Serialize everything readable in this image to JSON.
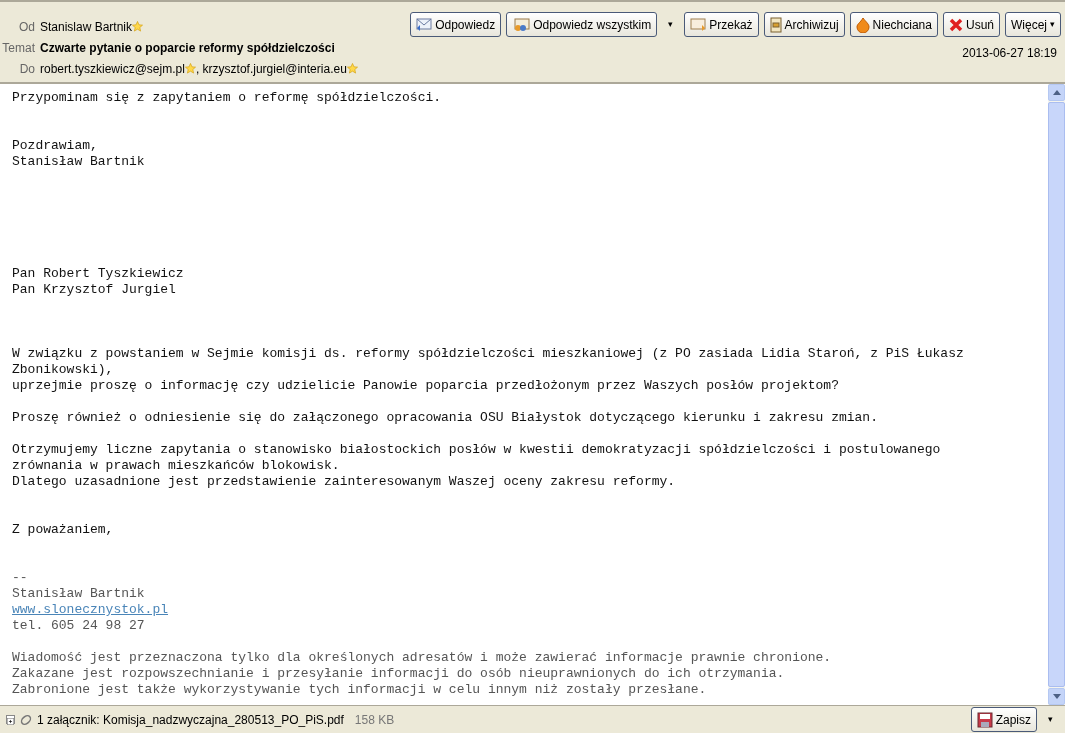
{
  "header": {
    "fields": [
      {
        "label": "Od",
        "kind": "contacts",
        "contacts": [
          "Stanislaw Bartnik"
        ]
      },
      {
        "label": "Temat",
        "kind": "subject",
        "value": "Czwarte pytanie o poparcie reformy spółdzielczości"
      },
      {
        "label": "Do",
        "kind": "contacts",
        "separator": ",",
        "contacts": [
          "robert.tyszkiewicz@sejm.pl",
          "krzysztof.jurgiel@interia.eu"
        ]
      }
    ],
    "buttons": [
      {
        "label": "Odpowiedz",
        "kind": "plain"
      },
      {
        "label": "Odpowiedz wszystkim",
        "kind": "split",
        "menu": "▾"
      },
      {
        "label": "Przekaż",
        "kind": "plain"
      },
      {
        "label": "Archiwizuj",
        "kind": "plain"
      },
      {
        "label": "Niechciana",
        "kind": "plain"
      },
      {
        "label": "Usuń",
        "kind": "plain"
      },
      {
        "label": "Więcej",
        "kind": "menu",
        "menu": "▾"
      }
    ],
    "date": "2013-06-27 18:19"
  },
  "body": [
    {
      "kind": "text",
      "lines": [
        "Przypominam się z zapytaniem o reformę spółdzielczości."
      ]
    },
    {
      "kind": "text",
      "lines": [
        "Pozdrawiam,",
        "Stanisław Bartnik"
      ]
    },
    {
      "kind": "text",
      "lines": [
        "Pan Robert Tyszkiewicz",
        "Pan Krzysztof Jurgiel"
      ]
    },
    {
      "kind": "text",
      "lines": [
        "W związku z powstaniem w Sejmie komisji ds. reformy spółdzielczości mieszkaniowej (z PO zasiada Lidia Staroń, z PiS Łukasz Zbonikowski),",
        "uprzejmie proszę o informację czy udzielicie Panowie poparcia przedłożonym przez Waszych posłów projektom?"
      ]
    },
    {
      "kind": "text",
      "lines": [
        "Proszę również o odniesienie się do załączonego opracowania OSU Białystok dotyczącego kierunku i zakresu zmian."
      ]
    },
    {
      "kind": "text",
      "lines": [
        "Otrzymujemy liczne zapytania o stanowisko białostockich posłów w kwestii demokratyzacji spółdzielczości i postulowanego zrównania w prawach mieszkańców blokowisk.",
        "Dlatego uzasadnione jest przedstawienie zainteresowanym Waszej oceny zakresu reformy."
      ]
    },
    {
      "kind": "text",
      "lines": [
        "Z poważaniem,"
      ]
    },
    {
      "kind": "signature",
      "lines": [
        "--",
        "Stanisław Bartnik"
      ],
      "link": "www.slonecznystok.pl",
      "after": [
        "tel. 605 24 98 27"
      ]
    },
    {
      "kind": "quote",
      "lines": [
        "Wiadomość jest przeznaczona tylko dla określonych adresatów i może zawierać informacje prawnie chronione.",
        "Zakazane jest rozpowszechnianie i przesyłanie informacji do osób nieuprawnionych do ich otrzymania.",
        "Zabronione jest także wykorzystywanie tych informacji w celu innym niż zostały przesłane."
      ]
    }
  ],
  "attachments": {
    "expanded": false,
    "summary": "1 załącznik: Komisja_nadzwyczajna_280513_PO_PiS.pdf",
    "size": "158 KB",
    "save": "Zapisz",
    "menu": "▾"
  }
}
